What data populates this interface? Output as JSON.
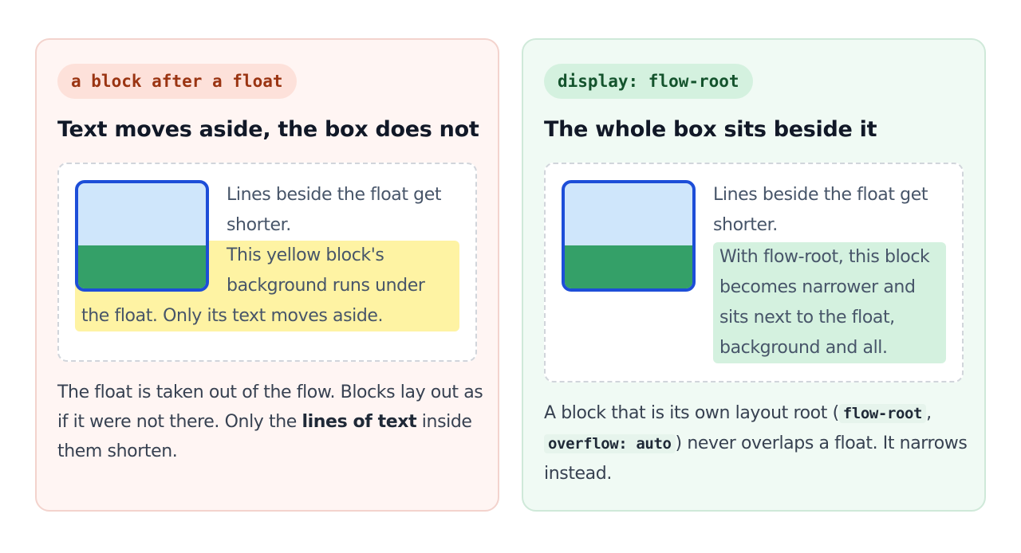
{
  "left_card": {
    "pill": "a block after a float",
    "heading": "Text moves aside, the box does not",
    "demo": {
      "line_text": "Lines beside the float get shorter.",
      "block_text": "This yellow block's background runs under the float. Only its text moves aside."
    },
    "footer": {
      "part1": "The float is taken out of the flow. Blocks lay out as if it were not there. Only the ",
      "bold": "lines of text",
      "part2": " inside them shorten."
    }
  },
  "right_card": {
    "pill": "display: flow-root",
    "heading": "The whole box sits beside it",
    "demo": {
      "line_text": "Lines beside the float get shorter.",
      "block_text": "With flow-root, this block becomes narrower and sits next to the float, background and all."
    },
    "footer": {
      "part1": "A block that is its own layout root (",
      "code1": "flow-root",
      "sep": ", ",
      "code2": "overflow: auto",
      "part2": ") never overlaps a float. It narrows instead."
    }
  },
  "colors": {
    "float_border": "#1d4ed8",
    "sky": "#cfe6fb",
    "ground": "#34a068",
    "yellow_block": "#fef3a3",
    "green_block": "#d4f1df"
  },
  "icons": {
    "float_image": "landscape-icon"
  }
}
